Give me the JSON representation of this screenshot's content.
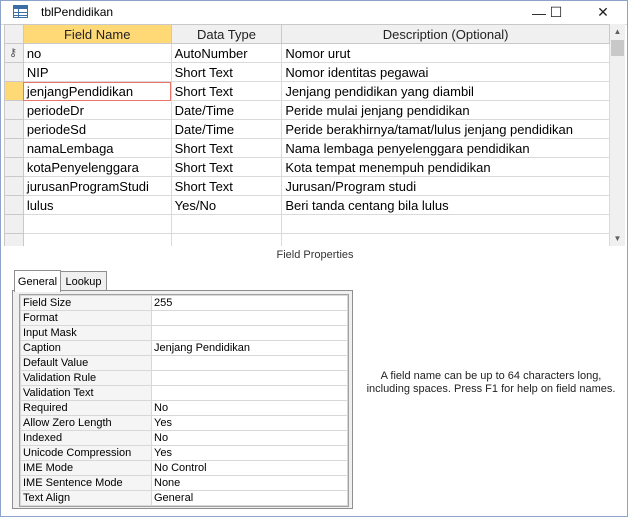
{
  "window": {
    "title": "tblPendidikan",
    "minimize_glyph": "—",
    "maximize_glyph": "☐",
    "close_glyph": "✕"
  },
  "grid": {
    "headers": [
      "Field Name",
      "Data Type",
      "Description (Optional)"
    ],
    "rows": [
      {
        "name": "no",
        "type": "AutoNumber",
        "desc": "Nomor urut",
        "key": true
      },
      {
        "name": "NIP",
        "type": "Short Text",
        "desc": "Nomor identitas pegawai"
      },
      {
        "name": "jenjangPendidikan",
        "type": "Short Text",
        "desc": "Jenjang pendidikan yang diambil",
        "current": true
      },
      {
        "name": "periodeDr",
        "type": "Date/Time",
        "desc": "Peride mulai jenjang pendidikan"
      },
      {
        "name": "periodeSd",
        "type": "Date/Time",
        "desc": "Peride berakhirnya/tamat/lulus jenjang pendidikan"
      },
      {
        "name": "namaLembaga",
        "type": "Short Text",
        "desc": "Nama lembaga penyelenggara pendidikan"
      },
      {
        "name": "kotaPenyelenggara",
        "type": "Short Text",
        "desc": "Kota tempat menempuh pendidikan"
      },
      {
        "name": "jurusanProgramStudi",
        "type": "Short Text",
        "desc": "Jurusan/Program studi"
      },
      {
        "name": "lulus",
        "type": "Yes/No",
        "desc": "Beri tanda centang bila lulus"
      },
      {
        "name": "",
        "type": "",
        "desc": ""
      },
      {
        "name": "",
        "type": "",
        "desc": ""
      }
    ]
  },
  "field_properties": {
    "label": "Field Properties",
    "tabs": [
      "General",
      "Lookup"
    ],
    "active_tab": "General",
    "properties": [
      {
        "name": "Field Size",
        "value": "255"
      },
      {
        "name": "Format",
        "value": ""
      },
      {
        "name": "Input Mask",
        "value": ""
      },
      {
        "name": "Caption",
        "value": "Jenjang Pendidikan"
      },
      {
        "name": "Default Value",
        "value": ""
      },
      {
        "name": "Validation Rule",
        "value": ""
      },
      {
        "name": "Validation Text",
        "value": ""
      },
      {
        "name": "Required",
        "value": "No"
      },
      {
        "name": "Allow Zero Length",
        "value": "Yes"
      },
      {
        "name": "Indexed",
        "value": "No"
      },
      {
        "name": "Unicode Compression",
        "value": "Yes"
      },
      {
        "name": "IME Mode",
        "value": "No Control"
      },
      {
        "name": "IME Sentence Mode",
        "value": "None"
      },
      {
        "name": "Text Align",
        "value": "General"
      }
    ]
  },
  "help_text": "A field name can be up to 64 characters long, including spaces. Press F1 for help on field names.",
  "colors": {
    "accent_header": "#ffd976",
    "edit_outline": "#e8756a"
  },
  "icons": {
    "table": "table-icon",
    "key": "primary-key-icon"
  }
}
